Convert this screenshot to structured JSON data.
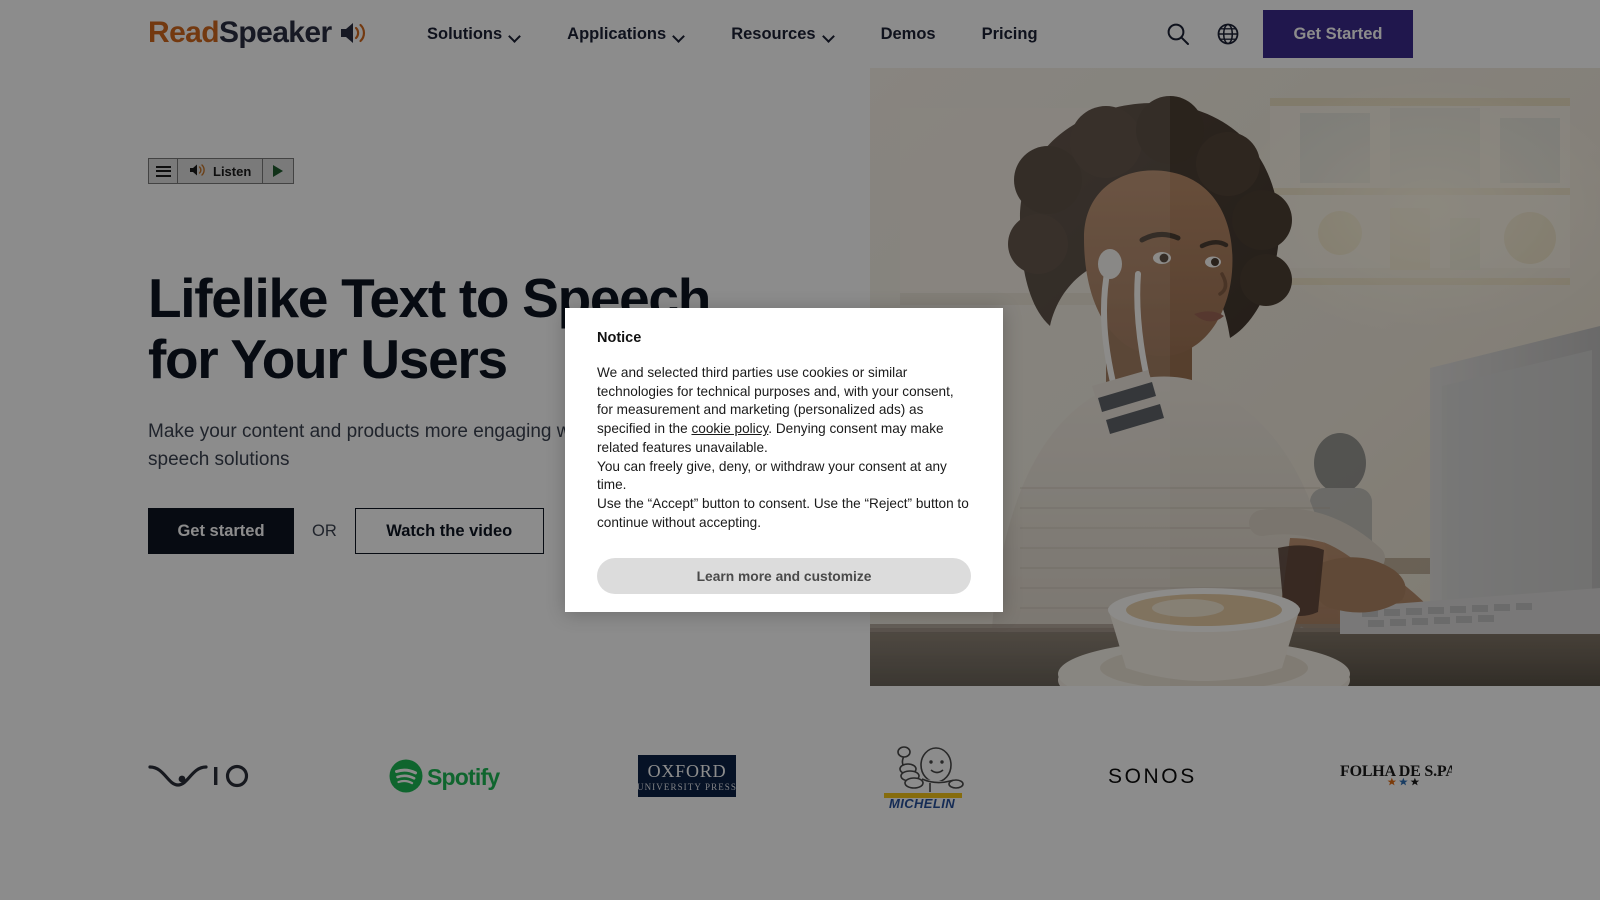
{
  "header": {
    "logo": {
      "part1": "Read",
      "part2": "Speaker",
      "icon": "speaker-icon"
    },
    "nav": [
      {
        "label": "Solutions",
        "has_dropdown": true
      },
      {
        "label": "Applications",
        "has_dropdown": true
      },
      {
        "label": "Resources",
        "has_dropdown": true
      },
      {
        "label": "Demos",
        "has_dropdown": false
      },
      {
        "label": "Pricing",
        "has_dropdown": false
      }
    ],
    "search_icon": "search-icon",
    "language_icon": "globe-icon",
    "cta_label": "Get Started",
    "cta_color": "#3b2a8c"
  },
  "listen_widget": {
    "menu_icon": "hamburger-menu-icon",
    "speaker_icon": "speaker-icon",
    "label": "Listen",
    "play_icon": "play-icon"
  },
  "hero": {
    "title_line1": "Lifelike Text to Speech",
    "title_line2": "for Your Users",
    "subtitle": "Make your content and products more engaging with our text to speech solutions",
    "primary_cta": "Get started",
    "divider": "OR",
    "secondary_cta": "Watch the video",
    "image_alt": "woman-with-headphones-at-laptop-in-cafe"
  },
  "logo_strip": {
    "brands": [
      {
        "name": "VAIO",
        "color": "#2b2f3a"
      },
      {
        "name": "Spotify",
        "color": "#1db954"
      },
      {
        "name": "Oxford University Press",
        "line1": "OXFORD",
        "line2": "UNIVERSITY PRESS",
        "color": "#ffffff",
        "bg": "#0b2146"
      },
      {
        "name": "MICHELIN",
        "color": "#27509b",
        "accent": "#f5c518"
      },
      {
        "name": "SONOS",
        "color": "#0b0b0b"
      },
      {
        "name": "FOLHA DE S.PAULO",
        "color": "#1a1a1a",
        "stars": [
          "#e06a12",
          "#2f6fb5",
          "#1a1a1a"
        ]
      }
    ]
  },
  "consent": {
    "title": "Notice",
    "paragraph1_a": "We and selected third parties use cookies or similar technologies for technical purposes and, with your consent, for measurement and marketing (personalized ads) as specified in the ",
    "cookie_policy_link": "cookie policy",
    "paragraph1_b": ". Denying consent may make related features unavailable.",
    "paragraph2": "You can freely give, deny, or withdraw your consent at any time.",
    "paragraph3": "Use the “Accept” button to consent. Use the “Reject” button to continue without accepting.",
    "learn_more_label": "Learn more and customize"
  }
}
